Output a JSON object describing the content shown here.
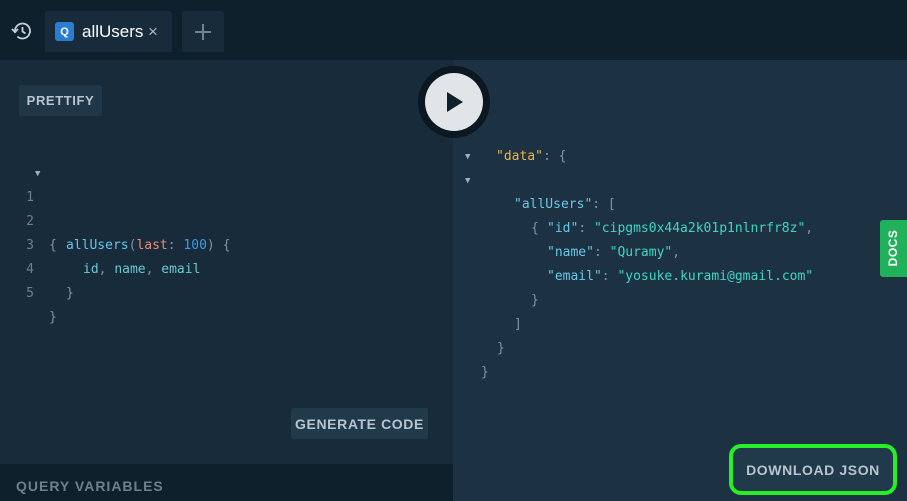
{
  "tab": {
    "badge": "Q",
    "title": "allUsers",
    "close": "×",
    "new_tab": "+"
  },
  "toolbar": {
    "prettify": "PRETTIFY",
    "generate_code": "GENERATE CODE",
    "query_variables": "QUERY VARIABLES"
  },
  "docs": "DOCS",
  "download_json": "DOWNLOAD JSON",
  "query": {
    "line_numbers": [
      "1",
      "2",
      "3",
      "4",
      "5"
    ],
    "brace_open": "{",
    "field": "allUsers",
    "paren_open": "(",
    "arg_name": "last",
    "colon": ":",
    "arg_value": "100",
    "paren_close": ")",
    "inner_open": "{",
    "fields": [
      "id",
      "name",
      "email"
    ],
    "inner_close": "}",
    "brace_close": "}"
  },
  "result": {
    "data_key": "\"data\"",
    "all_users_key": "\"allUsers\"",
    "user": [
      {
        "key": "\"id\"",
        "value": "\"cipgms0x44a2k01p1nlnrfr8z\""
      },
      {
        "key": "\"name\"",
        "value": "\"Quramy\""
      },
      {
        "key": "\"email\"",
        "value": "\"yosuke.kurami@gmail.com\""
      }
    ]
  }
}
